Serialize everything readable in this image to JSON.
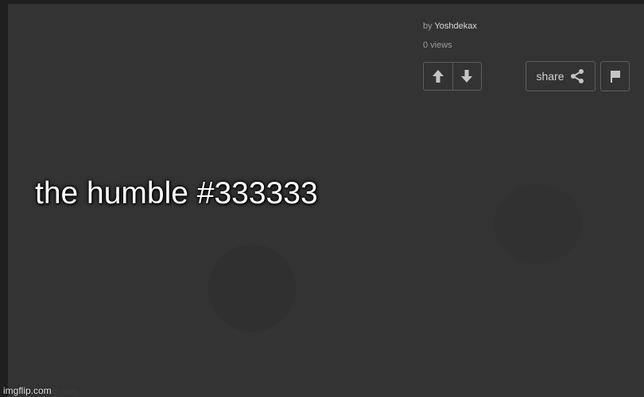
{
  "post": {
    "by_prefix": "by",
    "author": "Yoshdekax",
    "views": "0 views",
    "share_label": "share"
  },
  "caption": "the humble #333333",
  "watermark": "imgflip.com",
  "icons": {
    "upvote": "arrow-up-icon",
    "downvote": "arrow-down-icon",
    "share": "share-icon",
    "flag": "flag-icon"
  },
  "colors": {
    "background": "#333333",
    "frame": "#1f1f1f",
    "button_border": "#5e5e5e",
    "caption_text": "#ffffff"
  }
}
